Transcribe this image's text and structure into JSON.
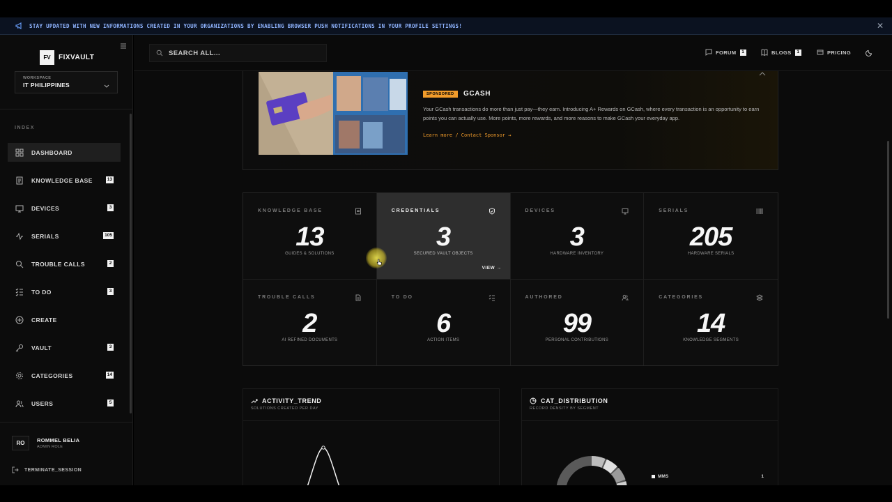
{
  "banner": {
    "text": "STAY UPDATED WITH NEW INFORMATIONS CREATED IN YOUR ORGANIZATIONS BY ENABLING BROWSER PUSH NOTIFICATIONS IN YOUR PROFILE SETTINGS!",
    "icon": "megaphone-icon"
  },
  "brand": {
    "logo_mark": "FV",
    "name": "FIXVAULT"
  },
  "workspace": {
    "label": "WORKSPACE",
    "value": "IT PHILIPPINES"
  },
  "sidebar": {
    "section_label": "INDEX",
    "items": [
      {
        "label": "DASHBOARD",
        "badge": "",
        "icon": "dashboard-icon"
      },
      {
        "label": "KNOWLEDGE BASE",
        "badge": "13",
        "icon": "book-icon"
      },
      {
        "label": "DEVICES",
        "badge": "3",
        "icon": "monitor-icon"
      },
      {
        "label": "SERIALS",
        "badge": "105",
        "icon": "activity-icon"
      },
      {
        "label": "TROUBLE CALLS",
        "badge": "2",
        "icon": "search-icon"
      },
      {
        "label": "TO DO",
        "badge": "3",
        "icon": "checklist-icon"
      },
      {
        "label": "CREATE",
        "badge": "",
        "icon": "plus-circle-icon"
      },
      {
        "label": "VAULT",
        "badge": "3",
        "icon": "key-icon"
      },
      {
        "label": "CATEGORIES",
        "badge": "14",
        "icon": "gear-icon"
      },
      {
        "label": "USERS",
        "badge": "5",
        "icon": "users-icon"
      }
    ]
  },
  "user": {
    "initials": "RO",
    "name": "ROMMEL BELIA",
    "role": "ADMIN ROLE"
  },
  "logout_label": "TERMINATE_SESSION",
  "header": {
    "search_placeholder": "SEARCH ALL...",
    "links": [
      {
        "label": "FORUM",
        "badge": "1",
        "icon": "chat-icon"
      },
      {
        "label": "BLOGS",
        "badge": "1",
        "icon": "open-book-icon"
      },
      {
        "label": "PRICING",
        "badge": "",
        "icon": "card-icon"
      }
    ]
  },
  "sponsor": {
    "badge": "SPONSORED",
    "name": "GCASH",
    "description": "Your GCash transactions do more than just pay—they earn. Introducing A+ Rewards on GCash, where every transaction is an opportunity to earn points you can actually use. More points, more rewards, and more reasons to make GCash your everyday app.",
    "link": "Learn more / Contact Sponsor →"
  },
  "stats": [
    {
      "label": "KNOWLEDGE BASE",
      "value": "13",
      "sub": "GUIDES & SOLUTIONS",
      "icon": "book-icon"
    },
    {
      "label": "CREDENTIALS",
      "value": "3",
      "sub": "SECURED VAULT OBJECTS",
      "icon": "shield-icon",
      "action": "VIEW →"
    },
    {
      "label": "DEVICES",
      "value": "3",
      "sub": "HARDWARE INVENTORY",
      "icon": "monitor-icon"
    },
    {
      "label": "SERIALS",
      "value": "205",
      "sub": "HARDWARE SERIALS",
      "icon": "barcode-icon"
    },
    {
      "label": "TROUBLE CALLS",
      "value": "2",
      "sub": "AI REFINED DOCUMENTS",
      "icon": "document-icon"
    },
    {
      "label": "TO DO",
      "value": "6",
      "sub": "ACTION ITEMS",
      "icon": "checklist-icon"
    },
    {
      "label": "AUTHORED",
      "value": "99",
      "sub": "PERSONAL CONTRIBUTIONS",
      "icon": "users-icon"
    },
    {
      "label": "CATEGORIES",
      "value": "14",
      "sub": "KNOWLEDGE SEGMENTS",
      "icon": "layers-icon"
    }
  ],
  "panels": {
    "activity": {
      "title": "ACTIVITY_TREND",
      "subtitle": "SOLUTIONS CREATED PER DAY",
      "icon": "trend-icon"
    },
    "distribution": {
      "title": "CAT_DISTRIBUTION",
      "subtitle": "RECORD DENSITY BY SEGMENT",
      "icon": "pie-icon",
      "legend": [
        {
          "name": "MMS",
          "value": "1"
        }
      ]
    }
  },
  "colors": {
    "accent": "#f29c2b",
    "banner_text": "#8fb4ff",
    "highlight_card": "#2e2e2e"
  }
}
